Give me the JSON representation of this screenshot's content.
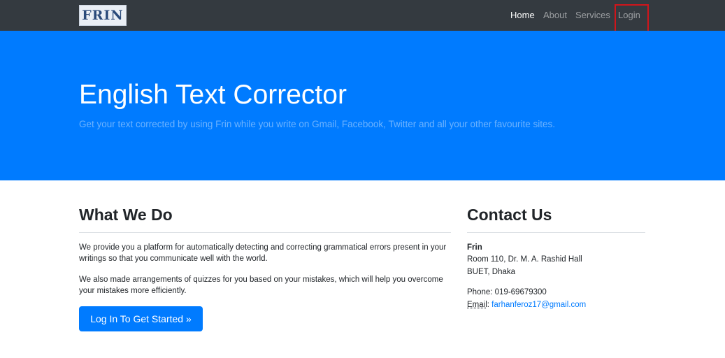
{
  "navbar": {
    "brand": "FRIN",
    "links": [
      {
        "label": "Home",
        "active": true
      },
      {
        "label": "About",
        "active": false
      },
      {
        "label": "Services",
        "active": false
      },
      {
        "label": "Login",
        "active": false
      }
    ]
  },
  "hero": {
    "title": "English Text Corrector",
    "lead": "Get your text corrected by using Frin while you write on Gmail, Facebook, Twitter and all your other favourite sites."
  },
  "what_we_do": {
    "title": "What We Do",
    "paragraphs": [
      "We provide you a platform for automatically detecting and correcting grammatical errors present in your writings so that you communicate well with the world.",
      "We also made arrangements of quizzes for you based on your mistakes, which will help you overcome your mistakes more efficiently."
    ],
    "cta_label": "Log In To Get Started »"
  },
  "contact": {
    "title": "Contact Us",
    "name": "Frin",
    "address_line1": "Room 110, Dr. M. A. Rashid Hall",
    "address_line2": "BUET, Dhaka",
    "phone": "Phone: 019-69679300",
    "email_label": "Email",
    "email_separator": ":",
    "email": "farhanferoz17@gmail.com"
  },
  "colors": {
    "navbar_bg": "#343a40",
    "primary": "#007bff",
    "highlight": "#d0151b"
  }
}
